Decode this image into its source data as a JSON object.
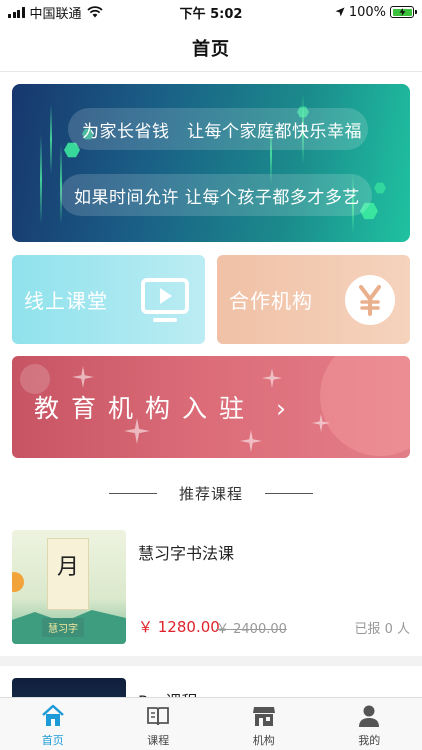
{
  "status_bar": {
    "carrier": "中国联通",
    "time": "下午 5:02",
    "battery": "100%",
    "battery_level": 1.0
  },
  "nav": {
    "title": "首页"
  },
  "banner": {
    "line1": "为家长省钱　让每个家庭都快乐幸福",
    "line2": "如果时间允许 让每个孩子都多才多艺"
  },
  "categories": {
    "online": {
      "label": "线上课堂",
      "icon": "play-screen-icon"
    },
    "partner": {
      "label": "合作机构",
      "icon": "yen-coin-icon"
    }
  },
  "join_banner": {
    "label": "教育机构入驻",
    "arrow": "›"
  },
  "section": {
    "title": "推荐课程"
  },
  "courses": [
    {
      "title": "慧习字书法课",
      "thumb_char": "月",
      "thumb_tag": "慧习字",
      "price": "￥ 1280.00",
      "original_price": "￥ 2400.00",
      "enrolled": "已报 0 人"
    },
    {
      "title": "P... 课程"
    }
  ],
  "tabs": [
    {
      "label": "首页",
      "icon": "home-icon",
      "active": true
    },
    {
      "label": "课程",
      "icon": "book-icon",
      "active": false
    },
    {
      "label": "机构",
      "icon": "store-icon",
      "active": false
    },
    {
      "label": "我的",
      "icon": "user-icon",
      "active": false
    }
  ],
  "colors": {
    "accent": "#1d9bd8",
    "price": "#e0212b",
    "online_card": "#8fe2ec",
    "partner_card": "#f0c1a6",
    "join_banner": "#d66472"
  }
}
